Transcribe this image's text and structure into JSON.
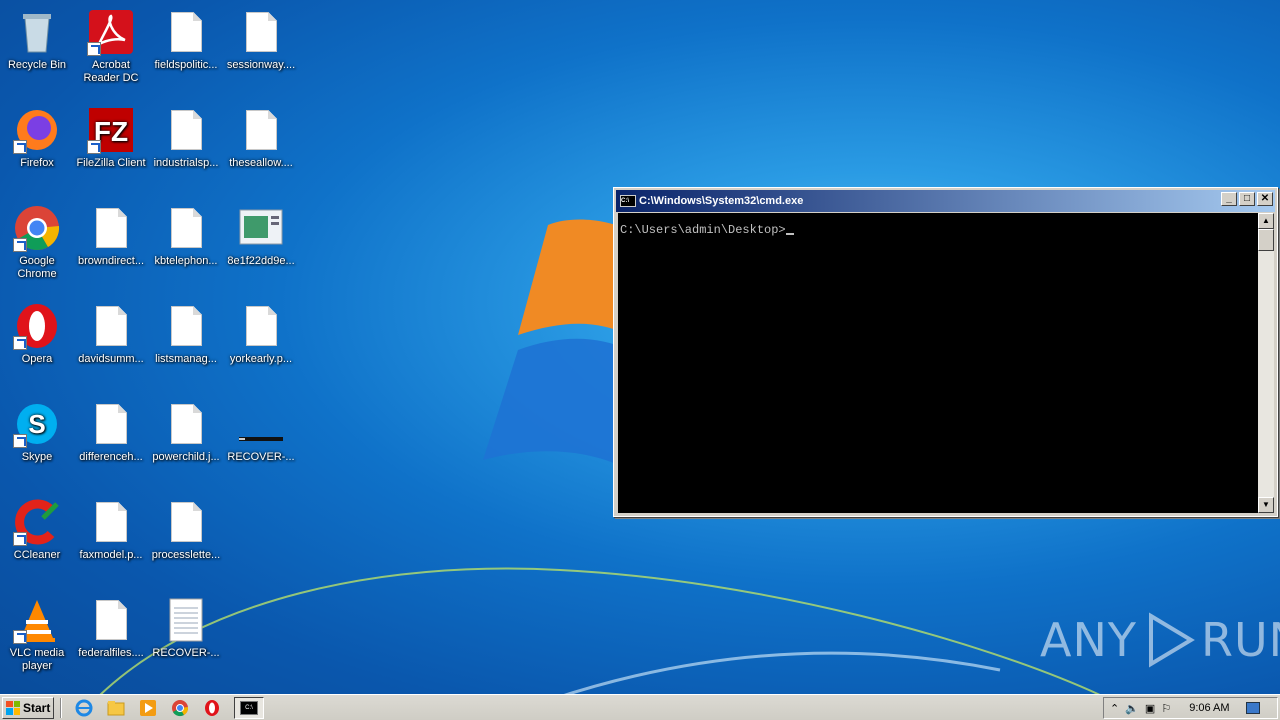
{
  "desktop": {
    "icons": [
      {
        "label": "Recycle Bin",
        "icon": "recycle-bin-icon"
      },
      {
        "label": "Acrobat Reader DC",
        "icon": "acrobat-icon"
      },
      {
        "label": "fieldspolitic...",
        "icon": "file-icon"
      },
      {
        "label": "sessionway....",
        "icon": "file-icon"
      },
      {
        "label": "Firefox",
        "icon": "firefox-icon"
      },
      {
        "label": "FileZilla Client",
        "icon": "filezilla-icon"
      },
      {
        "label": "industrialsp...",
        "icon": "file-icon"
      },
      {
        "label": "theseallow....",
        "icon": "file-icon"
      },
      {
        "label": "Google Chrome",
        "icon": "chrome-icon"
      },
      {
        "label": "browndirect...",
        "icon": "file-icon"
      },
      {
        "label": "kbtelephon...",
        "icon": "file-icon"
      },
      {
        "label": "8e1f22dd9e...",
        "icon": "image-file-icon"
      },
      {
        "label": "Opera",
        "icon": "opera-icon"
      },
      {
        "label": "davidsumm...",
        "icon": "file-icon"
      },
      {
        "label": "listsmanag...",
        "icon": "file-icon"
      },
      {
        "label": "yorkearly.p...",
        "icon": "file-icon"
      },
      {
        "label": "Skype",
        "icon": "skype-icon"
      },
      {
        "label": "differenceh...",
        "icon": "file-icon"
      },
      {
        "label": "powerchild.j...",
        "icon": "file-icon"
      },
      {
        "label": "RECOVER-...",
        "icon": "html-file-icon"
      },
      {
        "label": "CCleaner",
        "icon": "ccleaner-icon"
      },
      {
        "label": "faxmodel.p...",
        "icon": "file-icon"
      },
      {
        "label": "processlette...",
        "icon": "file-icon"
      },
      {
        "label": "VLC media player",
        "icon": "vlc-icon"
      },
      {
        "label": "federalfiles....",
        "icon": "file-icon"
      },
      {
        "label": "RECOVER-...",
        "icon": "text-file-icon"
      }
    ]
  },
  "cmd": {
    "title": "C:\\Windows\\System32\\cmd.exe",
    "prompt": "C:\\Users\\admin\\Desktop>",
    "buttons": {
      "minimize": "_",
      "maximize": "□",
      "close": "✕"
    }
  },
  "taskbar": {
    "start_label": "Start",
    "clock": "9:06 AM",
    "quick_launch": [
      "internet-explorer-icon",
      "explorer-folder-icon",
      "media-player-icon",
      "chrome-icon",
      "opera-icon"
    ],
    "active_task_icon": "cmd-icon"
  },
  "watermark": {
    "left": "ANY",
    "right": "RUN"
  },
  "colors": {
    "title_start": "#0a246a",
    "title_end": "#a6caf0",
    "taskbar": "#d4d0c8"
  }
}
